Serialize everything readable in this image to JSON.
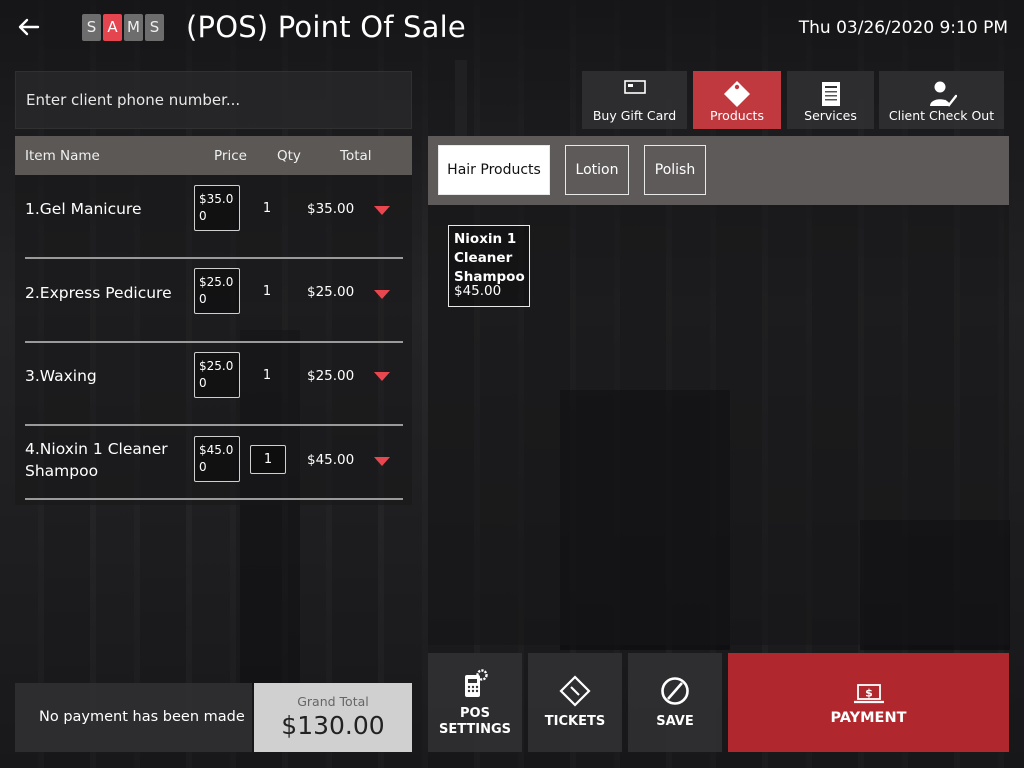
{
  "header": {
    "logo_letters": [
      "S",
      "A",
      "M",
      "S"
    ],
    "title": "(POS) Point Of Sale",
    "datetime": "Thu 03/26/2020 9:10 PM"
  },
  "client": {
    "phone_placeholder": "Enter client phone number..."
  },
  "items_table": {
    "columns": [
      "Item Name",
      "Price",
      "Qty",
      "Total"
    ],
    "rows": [
      {
        "name": "1.Gel Manicure",
        "price": "$35.00",
        "qty": "1",
        "total": "$35.00"
      },
      {
        "name": "2.Express Pedicure",
        "price": "$25.00",
        "qty": "1",
        "total": "$25.00"
      },
      {
        "name": "3.Waxing",
        "price": "$25.00",
        "qty": "1",
        "total": "$25.00"
      },
      {
        "name": "4.Nioxin 1 Cleaner Shampoo",
        "price": "$45.00",
        "qty": "1",
        "total": "$45.00"
      }
    ]
  },
  "top_buttons": [
    {
      "label": "Buy Gift Card",
      "icon": "gift-card-icon"
    },
    {
      "label": "Products",
      "icon": "tag-icon"
    },
    {
      "label": "Services",
      "icon": "menu-icon"
    },
    {
      "label": "Client Check Out",
      "icon": "user-check-icon"
    }
  ],
  "categories": [
    "Hair Products",
    "Lotion",
    "Polish"
  ],
  "products": [
    {
      "name": "Nioxin 1 Cleaner Shampoo",
      "price": "$45.00"
    }
  ],
  "footer": {
    "payment_status": "No payment has been made",
    "grand_total_label": "Grand Total",
    "grand_total_value": "$130.00",
    "pos_settings_line1": "POS",
    "pos_settings_line2": "SETTINGS",
    "tickets_label": "TICKETS",
    "save_label": "SAVE",
    "payment_label": "PAYMENT"
  },
  "colors": {
    "accent_red": "#c0393f",
    "payment_red": "#b0282e",
    "caret_red": "#e8474f"
  }
}
